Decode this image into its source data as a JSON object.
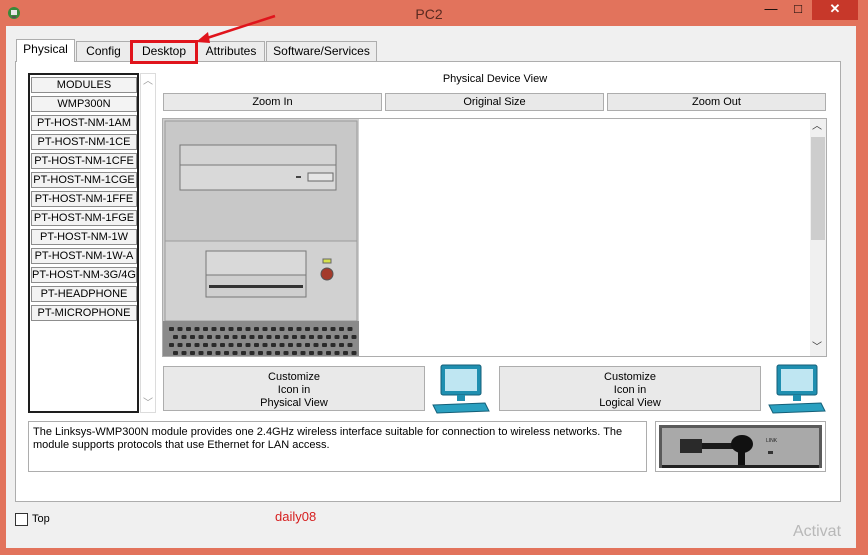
{
  "window": {
    "title": "PC2",
    "minimize_glyph": "—",
    "maximize_glyph": "□",
    "close_glyph": "✕",
    "icon": "pc-icon"
  },
  "tabs": [
    {
      "label": "Physical",
      "active": true
    },
    {
      "label": "Config"
    },
    {
      "label": "Desktop",
      "highlighted": true
    },
    {
      "label": "Attributes"
    },
    {
      "label": "Software/Services"
    }
  ],
  "modules": [
    "MODULES",
    "WMP300N",
    "PT-HOST-NM-1AM",
    "PT-HOST-NM-1CE",
    "PT-HOST-NM-1CFE",
    "PT-HOST-NM-1CGE",
    "PT-HOST-NM-1FFE",
    "PT-HOST-NM-1FGE",
    "PT-HOST-NM-1W",
    "PT-HOST-NM-1W-A",
    "PT-HOST-NM-3G/4G",
    "PT-HEADPHONE",
    "PT-MICROPHONE"
  ],
  "physical_view": {
    "title": "Physical Device View",
    "zoom_in": "Zoom In",
    "original_size": "Original Size",
    "zoom_out": "Zoom Out"
  },
  "customize_physical": {
    "line1": "Customize",
    "line2": "Icon in",
    "line3": "Physical View"
  },
  "customize_logical": {
    "line1": "Customize",
    "line2": "Icon in",
    "line3": "Logical View"
  },
  "description": "The Linksys-WMP300N module provides one 2.4GHz wireless interface suitable for connection to wireless networks. The module supports protocols that use Ethernet for LAN access.",
  "module_image": {
    "port_label": "LINK"
  },
  "footer": {
    "top_label": "Top",
    "watermark": "daily08",
    "activation_text": "Activat"
  },
  "colors": {
    "frame": "#e2735c",
    "highlight": "#e0141c",
    "close": "#c7382a"
  }
}
